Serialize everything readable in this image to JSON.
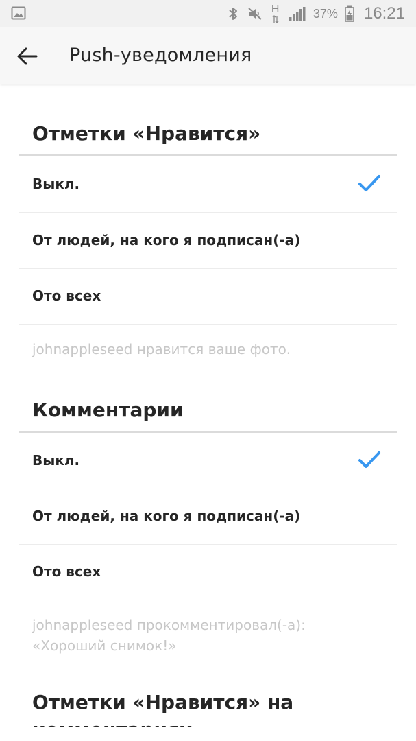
{
  "status_bar": {
    "battery_percent": "37%",
    "time": "16:21",
    "network_letter": "H"
  },
  "header": {
    "title": "Push-уведомления"
  },
  "sections": [
    {
      "title": "Отметки «Нравится»",
      "options": [
        "Выкл.",
        "От людей, на кого я подписан(-а)",
        "Ото всех"
      ],
      "selected_index": 0,
      "example_line1": "johnappleseed нравится ваше фото.",
      "example_line2": ""
    },
    {
      "title": "Комментарии",
      "options": [
        "Выкл.",
        "От людей, на кого я подписан(-а)",
        "Ото всех"
      ],
      "selected_index": 0,
      "example_line1": "johnappleseed прокомментировал(-а):",
      "example_line2": "«Хороший снимок!»"
    },
    {
      "title_line1": "Отметки «Нравится» на",
      "title_line2": "комментариях"
    }
  ],
  "colors": {
    "accent": "#3897f0",
    "text": "#262626",
    "muted": "#c7c7c7"
  }
}
